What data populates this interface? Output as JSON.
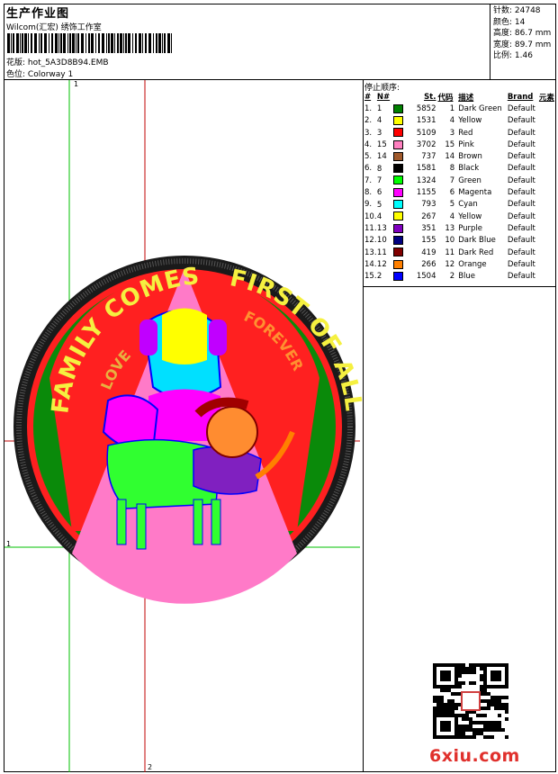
{
  "header": {
    "title": "生产作业图",
    "company": "Wilcom(汇宏) 绣饰工作室",
    "design_label": "花版:",
    "design_value": "hot_5A3D8B94.EMB",
    "color_label": "色位:",
    "color_value": "Colorway 1"
  },
  "stats": [
    {
      "label": "针数:",
      "value": "24748"
    },
    {
      "label": "颜色:",
      "value": "14"
    },
    {
      "label": "高度:",
      "value": "86.7 mm"
    },
    {
      "label": "宽度:",
      "value": "89.7 mm"
    },
    {
      "label": "比例:",
      "value": "1.46"
    }
  ],
  "stop_sequence": {
    "title": "停止顺序:",
    "headers": {
      "index": "#",
      "needle": "N#",
      "stitches": "St.",
      "code": "代码",
      "desc": "描述",
      "brand": "Brand",
      "element": "元素"
    },
    "rows": [
      {
        "i": "1.",
        "n": "1",
        "st": "5852",
        "c": "1",
        "d": "Dark Green",
        "b": "Default",
        "color": "#008000"
      },
      {
        "i": "2.",
        "n": "4",
        "st": "1531",
        "c": "4",
        "d": "Yellow",
        "b": "Default",
        "color": "#ffff00"
      },
      {
        "i": "3.",
        "n": "3",
        "st": "5109",
        "c": "3",
        "d": "Red",
        "b": "Default",
        "color": "#ff0000"
      },
      {
        "i": "4.",
        "n": "15",
        "st": "3702",
        "c": "15",
        "d": "Pink",
        "b": "Default",
        "color": "#ff80c0"
      },
      {
        "i": "5.",
        "n": "14",
        "st": "737",
        "c": "14",
        "d": "Brown",
        "b": "Default",
        "color": "#a05a2c"
      },
      {
        "i": "6.",
        "n": "8",
        "st": "1581",
        "c": "8",
        "d": "Black",
        "b": "Default",
        "color": "#000000"
      },
      {
        "i": "7.",
        "n": "7",
        "st": "1324",
        "c": "7",
        "d": "Green",
        "b": "Default",
        "color": "#00ff00"
      },
      {
        "i": "8.",
        "n": "6",
        "st": "1155",
        "c": "6",
        "d": "Magenta",
        "b": "Default",
        "color": "#ff00ff"
      },
      {
        "i": "9.",
        "n": "5",
        "st": "793",
        "c": "5",
        "d": "Cyan",
        "b": "Default",
        "color": "#00ffff"
      },
      {
        "i": "10.",
        "n": "4",
        "st": "267",
        "c": "4",
        "d": "Yellow",
        "b": "Default",
        "color": "#ffff00"
      },
      {
        "i": "11.",
        "n": "13",
        "st": "351",
        "c": "13",
        "d": "Purple",
        "b": "Default",
        "color": "#8000c0"
      },
      {
        "i": "12.",
        "n": "10",
        "st": "155",
        "c": "10",
        "d": "Dark Blue",
        "b": "Default",
        "color": "#000080"
      },
      {
        "i": "13.",
        "n": "11",
        "st": "419",
        "c": "11",
        "d": "Dark Red",
        "b": "Default",
        "color": "#800000"
      },
      {
        "i": "14.",
        "n": "12",
        "st": "266",
        "c": "12",
        "d": "Orange",
        "b": "Default",
        "color": "#ff8000"
      },
      {
        "i": "15.",
        "n": "2",
        "st": "1504",
        "c": "2",
        "d": "Blue",
        "b": "Default",
        "color": "#0000ff"
      }
    ]
  },
  "guides": {
    "top_label": "1",
    "left_label": "1",
    "bottom_label": "2"
  },
  "design_text": {
    "top_left": "FAMILY COMES",
    "top_right": "FIRST OF ALL",
    "inner_left": "LOVE",
    "inner_right": "FOREVER"
  },
  "watermark": "6xiu.com"
}
